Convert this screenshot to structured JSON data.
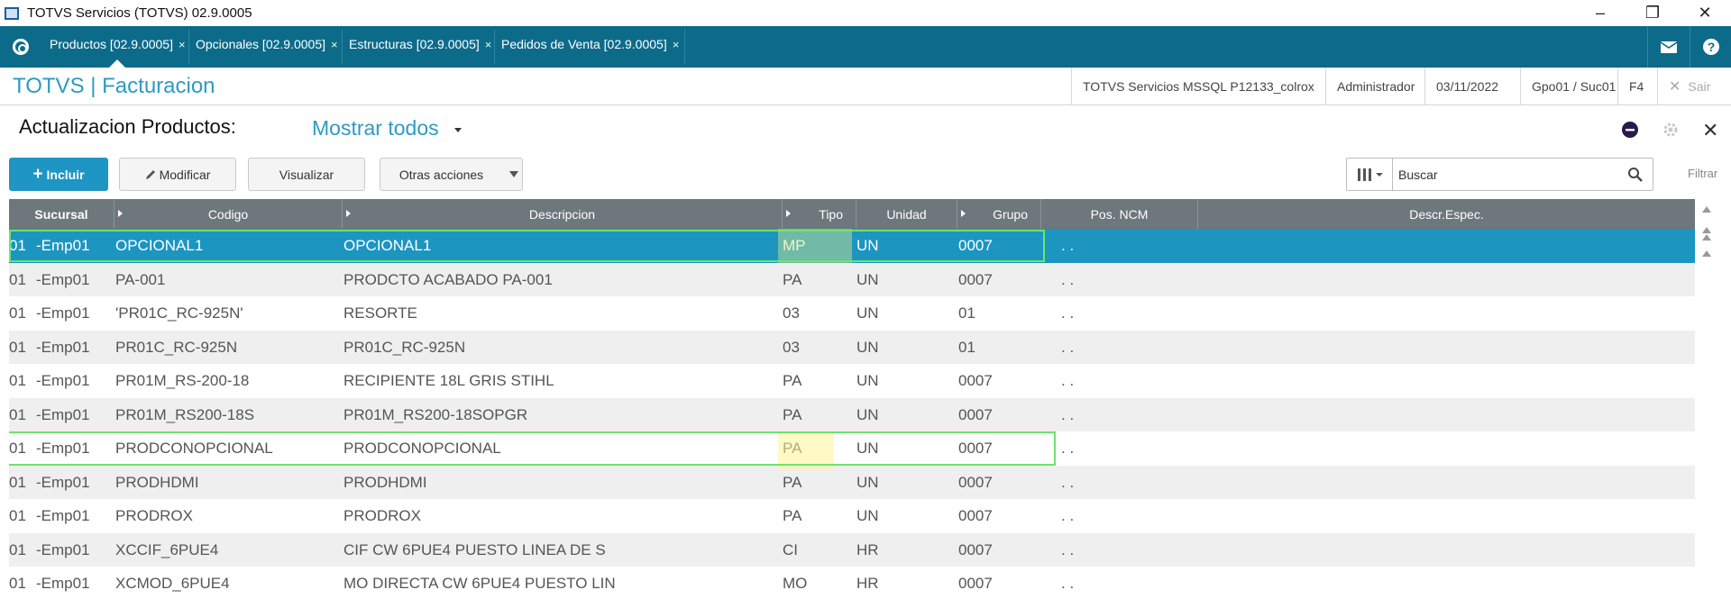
{
  "window": {
    "title": "TOTVS Servicios (TOTVS) 02.9.0005"
  },
  "tabs": [
    {
      "label": "Productos [02.9.0005]",
      "close": "×"
    },
    {
      "label": "Opcionales [02.9.0005]",
      "close": "×"
    },
    {
      "label": "Estructuras [02.9.0005]",
      "close": "×"
    },
    {
      "label": "Pedidos de Venta [02.9.0005]",
      "close": "×"
    }
  ],
  "module": {
    "title": "TOTVS | Facturacion",
    "environment": "TOTVS Servicios MSSQL P12133_colrox",
    "user": "Administrador",
    "date": "03/11/2022",
    "branch": "Gpo01 / Suc01",
    "key": "F4",
    "exit_label": "Sair"
  },
  "page": {
    "title": "Actualizacion Productos:",
    "view_selector": "Mostrar todos"
  },
  "toolbar": {
    "incluir": "Incluir",
    "modificar": "Modificar",
    "visualizar": "Visualizar",
    "otras": "Otras acciones"
  },
  "search": {
    "placeholder": "Buscar",
    "value": "Buscar",
    "filter_label": "Filtrar"
  },
  "grid": {
    "columns": [
      "Sucursal",
      "Codigo",
      "Descripcion",
      "Tipo",
      "Unidad",
      "Grupo",
      "Pos. NCM",
      "Descr.Espec."
    ],
    "rows": [
      {
        "suc": "01",
        "emp": "-Emp01",
        "codigo": "OPCIONAL1",
        "desc": "OPCIONAL1",
        "tipo": "MP",
        "unidad": "UN",
        "grupo": "0007",
        "ncm": ". ."
      },
      {
        "suc": "01",
        "emp": "-Emp01",
        "codigo": "PA-001",
        "desc": "PRODCTO ACABADO PA-001",
        "tipo": "PA",
        "unidad": "UN",
        "grupo": "0007",
        "ncm": ". ."
      },
      {
        "suc": "01",
        "emp": "-Emp01",
        "codigo": "'PR01C_RC-925N'",
        "desc": "RESORTE",
        "tipo": "03",
        "unidad": "UN",
        "grupo": "01",
        "ncm": ". ."
      },
      {
        "suc": "01",
        "emp": "-Emp01",
        "codigo": "PR01C_RC-925N",
        "desc": "PR01C_RC-925N",
        "tipo": "03",
        "unidad": "UN",
        "grupo": "01",
        "ncm": ". ."
      },
      {
        "suc": "01",
        "emp": "-Emp01",
        "codigo": "PR01M_RS-200-18",
        "desc": "RECIPIENTE 18L GRIS STIHL",
        "tipo": "PA",
        "unidad": "UN",
        "grupo": "0007",
        "ncm": ". ."
      },
      {
        "suc": "01",
        "emp": "-Emp01",
        "codigo": "PR01M_RS200-18S",
        "desc": "PR01M_RS200-18SOPGR",
        "tipo": "PA",
        "unidad": "UN",
        "grupo": "0007",
        "ncm": ". ."
      },
      {
        "suc": "01",
        "emp": "-Emp01",
        "codigo": "PRODCONOPCIONAL",
        "desc": "PRODCONOPCIONAL",
        "tipo": "PA",
        "unidad": "UN",
        "grupo": "0007",
        "ncm": ". ."
      },
      {
        "suc": "01",
        "emp": "-Emp01",
        "codigo": "PRODHDMI",
        "desc": "PRODHDMI",
        "tipo": "PA",
        "unidad": "UN",
        "grupo": "0007",
        "ncm": ". ."
      },
      {
        "suc": "01",
        "emp": "-Emp01",
        "codigo": "PRODROX",
        "desc": "PRODROX",
        "tipo": "PA",
        "unidad": "UN",
        "grupo": "0007",
        "ncm": ". ."
      },
      {
        "suc": "01",
        "emp": "-Emp01",
        "codigo": "XCCIF_6PUE4",
        "desc": "CIF CW 6PUE4 PUESTO LINEA DE S",
        "tipo": "CI",
        "unidad": "HR",
        "grupo": "0007",
        "ncm": ". ."
      },
      {
        "suc": "01",
        "emp": "-Emp01",
        "codigo": "XCMOD_6PUE4",
        "desc": "MO DIRECTA CW 6PUE4 PUESTO LIN",
        "tipo": "MO",
        "unidad": "HR",
        "grupo": "0007",
        "ncm": ". ."
      }
    ]
  },
  "colors": {
    "accent": "#2e9ac3",
    "tabbar": "#0d6b8a",
    "selected_row": "#1c95c0",
    "grid_header": "#6d777c"
  }
}
